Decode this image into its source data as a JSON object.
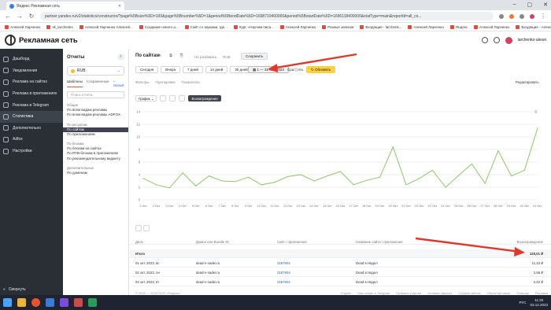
{
  "browser": {
    "tab_title": "Яндекс Рекламная сеть",
    "url": "partner.yandex.ru/v2/statistics/constructor/?page%5Bsize%5D=100&page%5Bnumber%5D=1&period%5BendDate%5D=1698710400000&period%5BstartDate%5D=1696118400000&statType=main&reportId=all_co...",
    "bookmarks": [
      "Алексей Ларченко",
      "vk_larchenko",
      "Алексей Ларченко Алексей...",
      "Создание нового и...",
      "Сайт со звуками, где...",
      "Курс «Научим писа...",
      "Алексей Ларченко",
      "Разные записки",
      "Входящие - larchenk...",
      "Алексей Ларченко",
      "Яндекс",
      "Алексей Ларченко",
      "Входящие - Алексей...",
      "Кабинет налоголла..."
    ]
  },
  "header": {
    "logo_text": "Рекламная сеть",
    "user_name": "larchenko-alexei"
  },
  "sidebar": {
    "items": [
      {
        "label": "Дашборд",
        "icon": "dashboard-icon"
      },
      {
        "label": "Уведомления",
        "icon": "bell-icon"
      },
      {
        "label": "Реклама на сайтах",
        "icon": "globe-icon"
      },
      {
        "label": "Реклама в приложениях",
        "icon": "phone-icon"
      },
      {
        "label": "Реклама в Telegram",
        "icon": "telegram-icon"
      },
      {
        "label": "Статистика",
        "icon": "chart-icon"
      },
      {
        "label": "Дополнительно",
        "icon": "folder-icon"
      },
      {
        "label": "Adfox",
        "icon": "adfox-icon"
      },
      {
        "label": "Настройки",
        "icon": "gear-icon"
      }
    ],
    "collapse_label": "Свернуть"
  },
  "reports": {
    "title": "Отчеты",
    "currency": "RUB",
    "tabs": [
      "Шаблоны",
      "Сохраненные"
    ],
    "new_label": "+ Новый",
    "search_placeholder": "Поиск отчета",
    "groups": [
      {
        "name": "Общие",
        "items": [
          "По всем видам рекламы",
          "По всем видам рекламы ADFOX"
        ]
      },
      {
        "name": "По ресурсам",
        "items": [
          "По сайтам",
          "По приложениям"
        ]
      },
      {
        "name": "По блокам",
        "items": [
          "По блокам на сайтах",
          "По RTB-блокам в приложениях",
          "По рекомендательному виджету"
        ]
      },
      {
        "name": "Дополнительные",
        "items": [
          "По доменам"
        ]
      }
    ],
    "selected": "По сайтам"
  },
  "main": {
    "title": "По сайтам",
    "toolbar_icons": [
      "edit-icon",
      "copy-icon",
      "link-icon"
    ],
    "breakdown_label": "Не разбивать",
    "currency_label": "RUB",
    "save_label": "Сохранить",
    "periods": [
      "Сегодня",
      "Вчера",
      "7 дней",
      "14 дней",
      "30 дней",
      "90 дней"
    ],
    "date_range": "1 — 31 окт. 2023",
    "compare_label": "Сравнить",
    "update_label": "Обновить",
    "filters": [
      "Фильтры",
      "Группировки",
      "Показатели"
    ],
    "edit_label": "Редактировать",
    "chart_type_label": "График",
    "reward_label": "Вознаграждение",
    "table": {
      "headers": [
        "Дата",
        "Домен или Bundle ID",
        "Сайт / приложение",
        "Название сайта / приложения",
        "Вознаграждение"
      ],
      "total_label": "Итого",
      "total_value": "120,01 ₽",
      "rows": [
        [
          "01 окт. 2023, вс",
          "dead-v-nadei.ru",
          "2187904",
          "Dead в Надел",
          "11,43 ₽"
        ],
        [
          "02 окт. 2023, пн",
          "dead-v-nadei.ru",
          "2187904",
          "Dead в Надел",
          "2,68 ₽"
        ],
        [
          "03 окт. 2023, вт",
          "dead-v-nadei.ru",
          "2187904",
          "Dead в Надел",
          "2,42 ₽"
        ]
      ]
    },
    "footer_left": "© 2009 — 2023 ООО «Яндекс»",
    "footer_links": [
      "English",
      "Наш канал в Telegram",
      "Правила участия",
      "Условия оферты",
      "Служба заботы",
      "Обратная связь",
      "Помощь",
      "Реклама"
    ]
  },
  "chart_data": {
    "type": "line",
    "categories": [
      "1 Окт",
      "2 Окт",
      "3 Окт",
      "4 Окт",
      "5 Окт",
      "6 Окт",
      "7 Окт",
      "8 Окт",
      "9 Окт",
      "10 Окт",
      "11 Окт",
      "12 Окт",
      "13 Окт",
      "14 Окт",
      "15 Окт",
      "16 Окт",
      "17 Окт",
      "18 Окт",
      "19 Окт",
      "20 Окт",
      "21 Окт",
      "22 Окт",
      "23 Окт",
      "24 Окт",
      "25 Окт",
      "26 Окт",
      "27 Окт",
      "28 Окт",
      "29 Окт",
      "30 Окт",
      "31 Окт"
    ],
    "values": [
      3.4,
      2.4,
      1.9,
      4.3,
      2.2,
      3.8,
      3.0,
      2.9,
      3.6,
      2.4,
      2.8,
      3.7,
      4.0,
      3.0,
      3.8,
      4.5,
      2.4,
      3.1,
      3.6,
      8.4,
      2.4,
      3.4,
      4.7,
      2.0,
      3.9,
      5.7,
      2.6,
      7.8,
      3.8,
      4.7,
      11.4
    ],
    "yticks": [
      0,
      2,
      4,
      6,
      8,
      10,
      12,
      14
    ],
    "ylim": [
      0,
      14
    ],
    "line_color": "#8dc86a"
  },
  "taskbar": {
    "time": "11:30",
    "date": "03.12.2023",
    "lang": "РУС"
  }
}
